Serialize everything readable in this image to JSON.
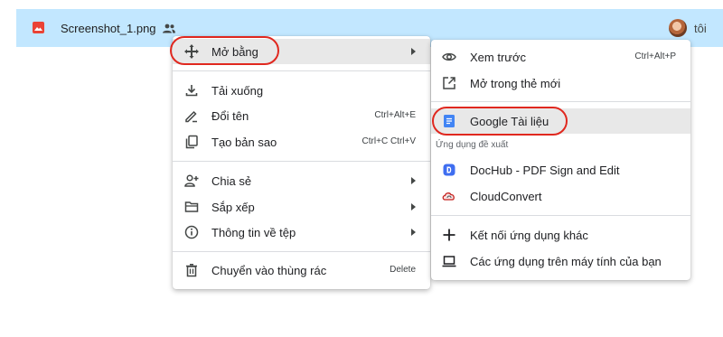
{
  "file": {
    "name": "Screenshot_1.png",
    "owner": "tôi",
    "icon": "image-file-icon",
    "shared_icon": "people-icon"
  },
  "menu": {
    "open_with": {
      "label": "Mở bằng",
      "icon": "move-arrows-icon"
    },
    "download": {
      "label": "Tải xuống",
      "icon": "download-icon"
    },
    "rename": {
      "label": "Đổi tên",
      "shortcut": "Ctrl+Alt+E",
      "icon": "rename-pen-icon"
    },
    "copy": {
      "label": "Tạo bản sao",
      "shortcut": "Ctrl+C Ctrl+V",
      "icon": "copy-icon"
    },
    "share": {
      "label": "Chia sẻ",
      "icon": "add-person-icon"
    },
    "organize": {
      "label": "Sắp xếp",
      "icon": "folder-icon"
    },
    "file_info": {
      "label": "Thông tin về tệp",
      "icon": "info-icon"
    },
    "trash": {
      "label": "Chuyển vào thùng rác",
      "shortcut": "Delete",
      "icon": "trash-icon"
    }
  },
  "submenu": {
    "preview": {
      "label": "Xem trước",
      "shortcut": "Ctrl+Alt+P",
      "icon": "eye-icon"
    },
    "new_tab": {
      "label": "Mở trong thẻ mới",
      "icon": "open-new-tab-icon"
    },
    "google_docs": {
      "label": "Google Tài liệu",
      "icon": "google-docs-icon"
    },
    "suggested_label": "Ứng dụng đề xuất",
    "dochub": {
      "label": "DocHub - PDF Sign and Edit",
      "icon": "dochub-icon"
    },
    "cloudconvert": {
      "label": "CloudConvert",
      "icon": "cloudconvert-icon"
    },
    "connect_more": {
      "label": "Kết nối ứng dụng khác",
      "icon": "plus-icon"
    },
    "desktop_apps": {
      "label": "Các ứng dụng trên máy tính của bạn",
      "icon": "laptop-icon"
    }
  },
  "colors": {
    "row_selected": "#c2e7ff",
    "highlight_ring": "#e0281f",
    "docs_blue": "#4285f4",
    "file_red": "#ea4335"
  }
}
